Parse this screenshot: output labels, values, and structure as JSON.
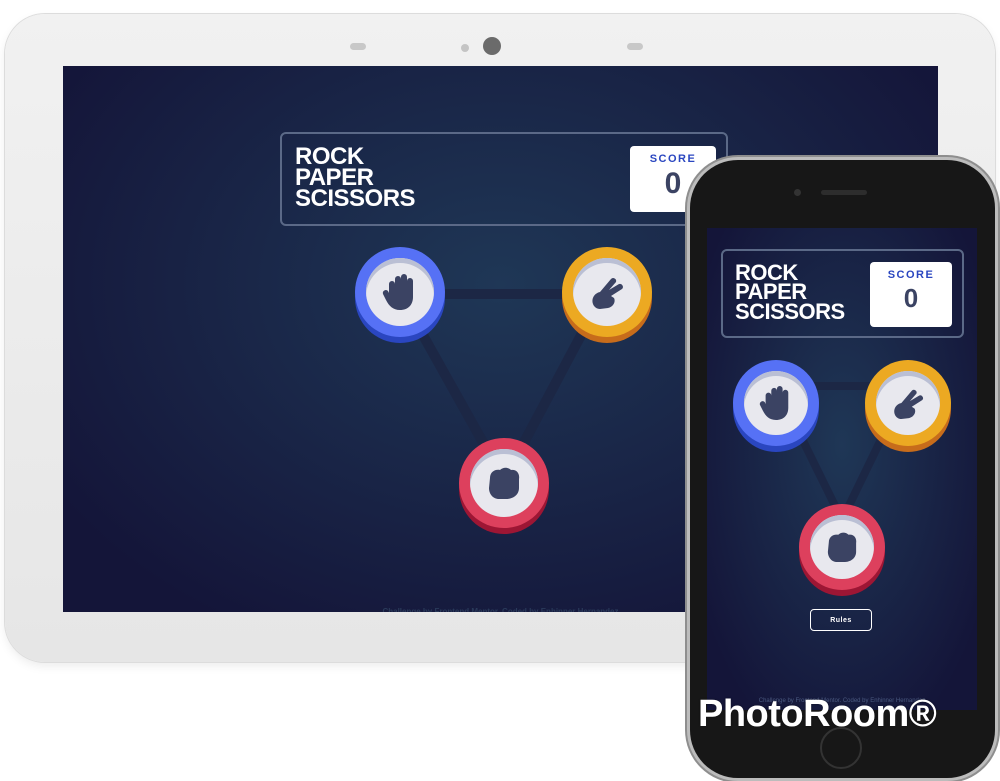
{
  "game": {
    "title_line1": "ROCK",
    "title_line2": "PAPER",
    "title_line3": "SCISSORS",
    "score_label": "SCORE",
    "score_value": "0"
  },
  "tokens": {
    "paper_icon": "hand-open-icon",
    "scissors_icon": "hand-scissors-icon",
    "rock_icon": "hand-fist-icon"
  },
  "rules_button": "Rules",
  "attribution": {
    "prefix": "Challenge by ",
    "site": "Frontend Mentor",
    "middle": ". Coded by ",
    "author": "Enhinner Hernandez"
  },
  "watermark": "PhotoRoom®",
  "colors": {
    "paper": "#5671f5",
    "scissors": "#eca922",
    "rock": "#dd405d",
    "background": "#1f3756",
    "score_label": "#2a46c0",
    "score_value": "#3b4363"
  }
}
